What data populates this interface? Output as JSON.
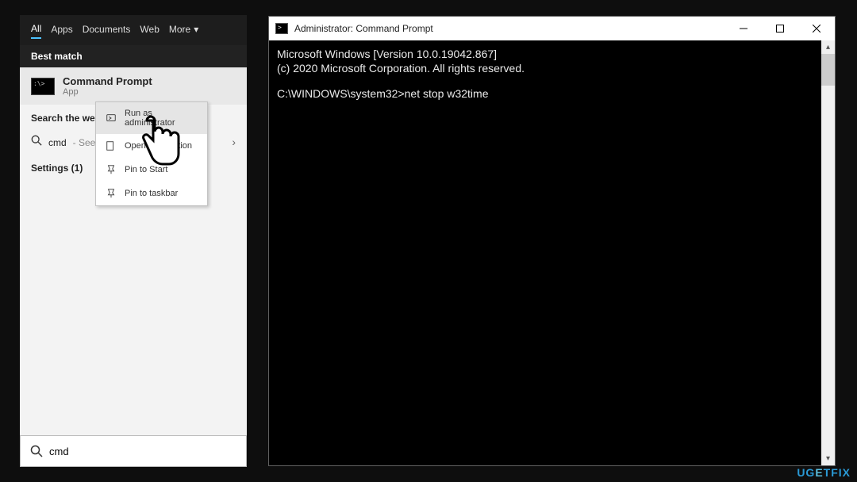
{
  "search_panel": {
    "tabs": {
      "all": "All",
      "apps": "Apps",
      "documents": "Documents",
      "web": "Web",
      "more": "More"
    },
    "best_match_label": "Best match",
    "best_match": {
      "name": "Command Prompt",
      "type": "App"
    },
    "search_web_label": "Search the web",
    "web_result": {
      "query": "cmd",
      "hint": "- See w"
    },
    "settings_label": "Settings (1)",
    "search_value": "cmd"
  },
  "context_menu": {
    "run_admin": "Run as administrator",
    "open_location": "Open file location",
    "pin_start": "Pin to Start",
    "pin_taskbar": "Pin to taskbar"
  },
  "cmd_window": {
    "title": "Administrator: Command Prompt",
    "line1": "Microsoft Windows [Version 10.0.19042.867]",
    "line2": "(c) 2020 Microsoft Corporation. All rights reserved.",
    "prompt_path": "C:\\WINDOWS\\system32>",
    "command": "net stop w32time"
  },
  "watermark": "UGETFIX"
}
